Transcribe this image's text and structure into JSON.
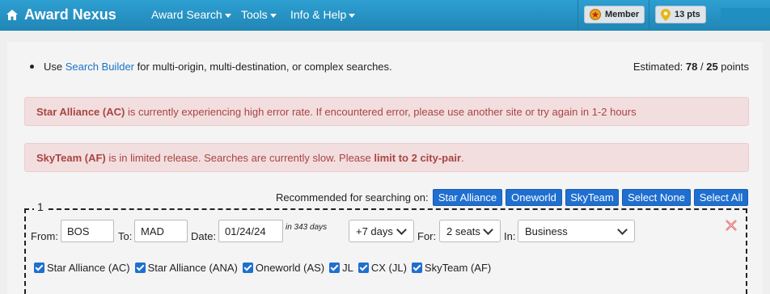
{
  "navbar": {
    "brand": "Award Nexus",
    "menu": [
      {
        "label": "Award Search"
      },
      {
        "label": "Tools"
      },
      {
        "label": "Info & Help"
      }
    ],
    "member_label": "Member",
    "points_label": "13 pts"
  },
  "tip": {
    "prefix": "Use ",
    "link": "Search Builder",
    "suffix": " for multi-origin, multi-destination, or complex searches."
  },
  "estimate": {
    "label": "Estimated: ",
    "used": "78",
    "sep": " / ",
    "total": "25",
    "unit": " points"
  },
  "alerts": [
    {
      "bold": "Star Alliance (AC)",
      "text": " is currently experiencing high error rate. If encountered error, please use another site or try again in 1-2 hours"
    },
    {
      "bold": "SkyTeam (AF)",
      "text": " is in limited release. Searches are currently slow. Please ",
      "bold2": "limit to 2 city-pair",
      "end": "."
    }
  ],
  "recommended": {
    "label": "Recommended for searching on:",
    "buttons": [
      "Star Alliance",
      "Oneworld",
      "SkyTeam",
      "Select None",
      "Select All"
    ]
  },
  "search": {
    "legend": "1",
    "from_label": "From:",
    "from_value": "BOS",
    "to_label": "To:",
    "to_value": "MAD",
    "date_label": "Date:",
    "date_value": "01/24/24",
    "date_hint": "in 343 days",
    "flex_value": "+7 days",
    "for_label": "For:",
    "seats_value": "2 seats",
    "in_label": "In:",
    "cabin_value": "Business"
  },
  "programs": [
    {
      "label": "Star Alliance (AC)",
      "checked": true
    },
    {
      "label": "Star Alliance (ANA)",
      "checked": true
    },
    {
      "label": "Oneworld (AS)",
      "checked": true
    },
    {
      "label": "JL",
      "checked": true
    },
    {
      "label": "CX (JL)",
      "checked": true
    },
    {
      "label": "SkyTeam (AF)",
      "checked": true
    }
  ],
  "colors": {
    "navbar": "#2186b6",
    "accent": "#1f6fd0",
    "alert_bg": "#f2dede",
    "alert_text": "#a94442"
  }
}
